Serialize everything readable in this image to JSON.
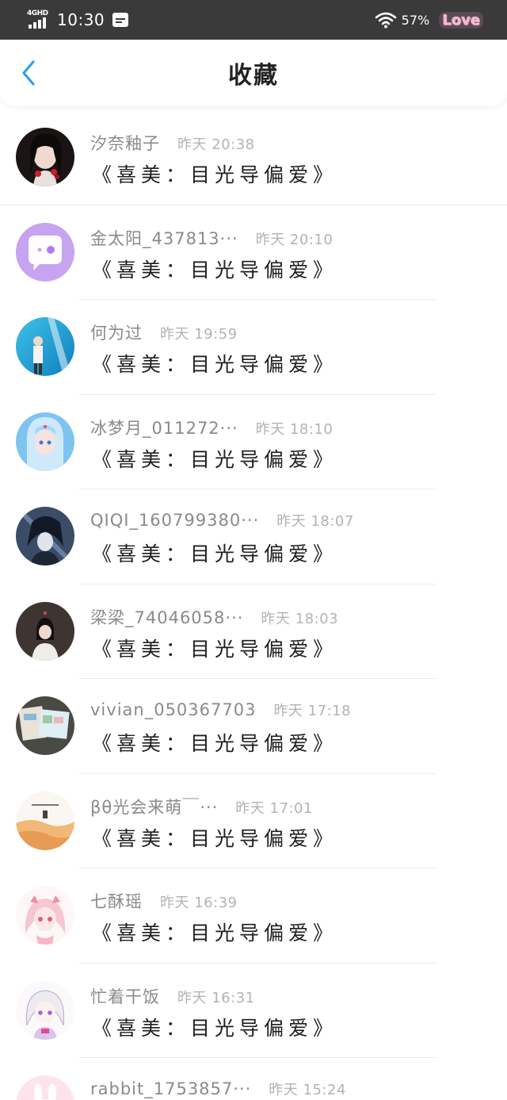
{
  "status_bar": {
    "network": "4GHD",
    "time": "10:30",
    "battery": "57%",
    "badge": "Love"
  },
  "header": {
    "title": "收藏",
    "back_icon": "chevron-left-icon"
  },
  "items": [
    {
      "name": "汐奈釉子",
      "time": "昨天 20:38",
      "title": "《喜美：目光导偏爱》",
      "avatar": "portrait-girl-dark"
    },
    {
      "name": "金太阳_437813···",
      "time": "昨天 20:10",
      "title": "《喜美：目光导偏爱》",
      "avatar": "purple-chat-bubble"
    },
    {
      "name": "何为过",
      "time": "昨天 19:59",
      "title": "《喜美：目光导偏爱》",
      "avatar": "blue-sky-boy"
    },
    {
      "name": "冰梦月_011272···",
      "time": "昨天 18:10",
      "title": "《喜美：目光导偏爱》",
      "avatar": "blue-hair-anime"
    },
    {
      "name": "QIQI_160799380···",
      "time": "昨天 18:07",
      "title": "《喜美：目光导偏爱》",
      "avatar": "dark-anime-boy"
    },
    {
      "name": "梁梁_74046058···",
      "time": "昨天 18:03",
      "title": "《喜美：目光导偏爱》",
      "avatar": "girl-dark-background"
    },
    {
      "name": "vivian_050367703",
      "time": "昨天 17:18",
      "title": "《喜美：目光导偏爱》",
      "avatar": "postcards"
    },
    {
      "name": "βθ光会来萌￣···",
      "time": "昨天 17:01",
      "title": "《喜美：目光导偏爱》",
      "avatar": "sunset-text"
    },
    {
      "name": "七酥瑶",
      "time": "昨天 16:39",
      "title": "《喜美：目光导偏爱》",
      "avatar": "pink-hair-anime"
    },
    {
      "name": "忙着干饭",
      "time": "昨天 16:31",
      "title": "《喜美：目光导偏爱》",
      "avatar": "white-hair-anime"
    },
    {
      "name": "rabbit_1753857···",
      "time": "昨天 15:24",
      "title": "",
      "avatar": "bunny-pink"
    }
  ],
  "colors": {
    "status_bar_bg": "#3a3a3a",
    "accent_blue": "#2f9ff0",
    "name_gray": "#8a8a8a",
    "time_gray": "#b3b3b3",
    "title_dark": "#1e1e1e"
  }
}
